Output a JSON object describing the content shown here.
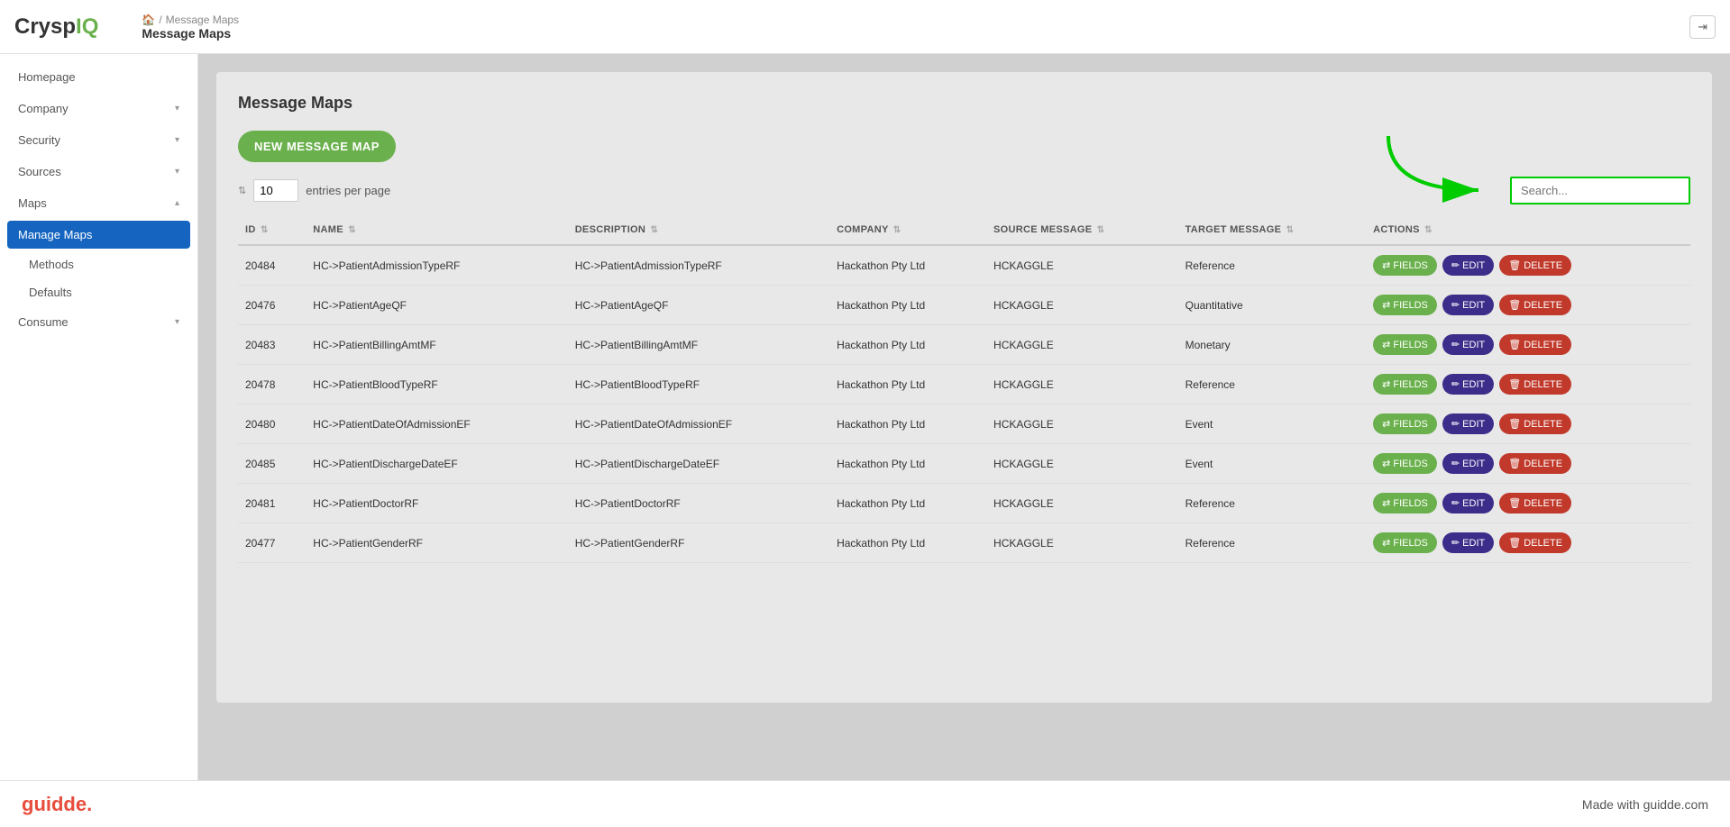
{
  "logo": {
    "text_before": "Crysp",
    "text_accent": "IQ"
  },
  "breadcrumb": {
    "home_icon": "🏠",
    "separator": "/",
    "parent": "Message Maps",
    "current": "Message Maps"
  },
  "logout_label": "⇥",
  "sidebar": {
    "items": [
      {
        "id": "homepage",
        "label": "Homepage",
        "has_chevron": false
      },
      {
        "id": "company",
        "label": "Company",
        "has_chevron": true
      },
      {
        "id": "security",
        "label": "Security",
        "has_chevron": true
      },
      {
        "id": "sources",
        "label": "Sources",
        "has_chevron": true
      },
      {
        "id": "maps",
        "label": "Maps",
        "has_chevron": true,
        "expanded": true
      }
    ],
    "maps_sub_items": [
      {
        "id": "manage-maps",
        "label": "Manage Maps",
        "active": true
      },
      {
        "id": "methods",
        "label": "Methods",
        "active": false
      },
      {
        "id": "defaults",
        "label": "Defaults",
        "active": false
      }
    ],
    "consume": {
      "label": "Consume",
      "has_chevron": true
    }
  },
  "content": {
    "title": "Message Maps",
    "new_button_label": "NEW MESSAGE MAP",
    "entries_label": "entries per page",
    "entries_value": "10",
    "search_placeholder": "Search...",
    "table": {
      "columns": [
        {
          "key": "id",
          "label": "ID"
        },
        {
          "key": "name",
          "label": "NAME"
        },
        {
          "key": "description",
          "label": "DESCRIPTION"
        },
        {
          "key": "company",
          "label": "COMPANY"
        },
        {
          "key": "source_message",
          "label": "SOURCE MESSAGE"
        },
        {
          "key": "target_message",
          "label": "TARGET MESSAGE"
        },
        {
          "key": "actions",
          "label": "ACTIONS"
        }
      ],
      "rows": [
        {
          "id": "20484",
          "name": "HC->PatientAdmissionTypeRF",
          "description": "HC->PatientAdmissionTypeRF",
          "company": "Hackathon Pty Ltd",
          "source_message": "HCKAGGLE",
          "target_message": "Reference"
        },
        {
          "id": "20476",
          "name": "HC->PatientAgeQF",
          "description": "HC->PatientAgeQF",
          "company": "Hackathon Pty Ltd",
          "source_message": "HCKAGGLE",
          "target_message": "Quantitative"
        },
        {
          "id": "20483",
          "name": "HC->PatientBillingAmtMF",
          "description": "HC->PatientBillingAmtMF",
          "company": "Hackathon Pty Ltd",
          "source_message": "HCKAGGLE",
          "target_message": "Monetary"
        },
        {
          "id": "20478",
          "name": "HC->PatientBloodTypeRF",
          "description": "HC->PatientBloodTypeRF",
          "company": "Hackathon Pty Ltd",
          "source_message": "HCKAGGLE",
          "target_message": "Reference"
        },
        {
          "id": "20480",
          "name": "HC->PatientDateOfAdmissionEF",
          "description": "HC->PatientDateOfAdmissionEF",
          "company": "Hackathon Pty Ltd",
          "source_message": "HCKAGGLE",
          "target_message": "Event"
        },
        {
          "id": "20485",
          "name": "HC->PatientDischargeDateEF",
          "description": "HC->PatientDischargeDateEF",
          "company": "Hackathon Pty Ltd",
          "source_message": "HCKAGGLE",
          "target_message": "Event"
        },
        {
          "id": "20481",
          "name": "HC->PatientDoctorRF",
          "description": "HC->PatientDoctorRF",
          "company": "Hackathon Pty Ltd",
          "source_message": "HCKAGGLE",
          "target_message": "Reference"
        },
        {
          "id": "20477",
          "name": "HC->PatientGenderRF",
          "description": "HC->PatientGenderRF",
          "company": "Hackathon Pty Ltd",
          "source_message": "HCKAGGLE",
          "target_message": "Reference"
        }
      ],
      "btn_fields": "⇄ FIELDS",
      "btn_edit": "✏ EDIT",
      "btn_delete": "🗑 DELETE"
    }
  },
  "footer": {
    "logo": "guidde.",
    "tagline": "Made with guidde.com"
  }
}
